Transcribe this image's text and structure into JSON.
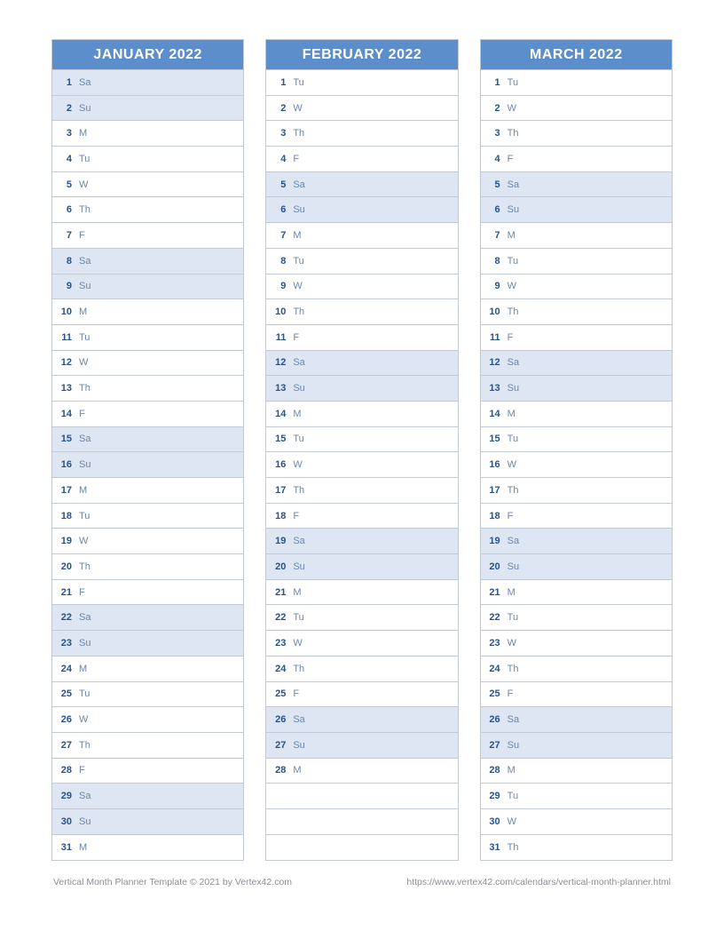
{
  "months": [
    {
      "title": "JANUARY 2022",
      "days": [
        {
          "n": "1",
          "d": "Sa",
          "w": true
        },
        {
          "n": "2",
          "d": "Su",
          "w": true
        },
        {
          "n": "3",
          "d": "M",
          "w": false
        },
        {
          "n": "4",
          "d": "Tu",
          "w": false
        },
        {
          "n": "5",
          "d": "W",
          "w": false
        },
        {
          "n": "6",
          "d": "Th",
          "w": false
        },
        {
          "n": "7",
          "d": "F",
          "w": false
        },
        {
          "n": "8",
          "d": "Sa",
          "w": true
        },
        {
          "n": "9",
          "d": "Su",
          "w": true
        },
        {
          "n": "10",
          "d": "M",
          "w": false
        },
        {
          "n": "11",
          "d": "Tu",
          "w": false
        },
        {
          "n": "12",
          "d": "W",
          "w": false
        },
        {
          "n": "13",
          "d": "Th",
          "w": false
        },
        {
          "n": "14",
          "d": "F",
          "w": false
        },
        {
          "n": "15",
          "d": "Sa",
          "w": true
        },
        {
          "n": "16",
          "d": "Su",
          "w": true
        },
        {
          "n": "17",
          "d": "M",
          "w": false
        },
        {
          "n": "18",
          "d": "Tu",
          "w": false
        },
        {
          "n": "19",
          "d": "W",
          "w": false
        },
        {
          "n": "20",
          "d": "Th",
          "w": false
        },
        {
          "n": "21",
          "d": "F",
          "w": false
        },
        {
          "n": "22",
          "d": "Sa",
          "w": true
        },
        {
          "n": "23",
          "d": "Su",
          "w": true
        },
        {
          "n": "24",
          "d": "M",
          "w": false
        },
        {
          "n": "25",
          "d": "Tu",
          "w": false
        },
        {
          "n": "26",
          "d": "W",
          "w": false
        },
        {
          "n": "27",
          "d": "Th",
          "w": false
        },
        {
          "n": "28",
          "d": "F",
          "w": false
        },
        {
          "n": "29",
          "d": "Sa",
          "w": true
        },
        {
          "n": "30",
          "d": "Su",
          "w": true
        },
        {
          "n": "31",
          "d": "M",
          "w": false
        }
      ]
    },
    {
      "title": "FEBRUARY 2022",
      "days": [
        {
          "n": "1",
          "d": "Tu",
          "w": false
        },
        {
          "n": "2",
          "d": "W",
          "w": false
        },
        {
          "n": "3",
          "d": "Th",
          "w": false
        },
        {
          "n": "4",
          "d": "F",
          "w": false
        },
        {
          "n": "5",
          "d": "Sa",
          "w": true
        },
        {
          "n": "6",
          "d": "Su",
          "w": true
        },
        {
          "n": "7",
          "d": "M",
          "w": false
        },
        {
          "n": "8",
          "d": "Tu",
          "w": false
        },
        {
          "n": "9",
          "d": "W",
          "w": false
        },
        {
          "n": "10",
          "d": "Th",
          "w": false
        },
        {
          "n": "11",
          "d": "F",
          "w": false
        },
        {
          "n": "12",
          "d": "Sa",
          "w": true
        },
        {
          "n": "13",
          "d": "Su",
          "w": true
        },
        {
          "n": "14",
          "d": "M",
          "w": false
        },
        {
          "n": "15",
          "d": "Tu",
          "w": false
        },
        {
          "n": "16",
          "d": "W",
          "w": false
        },
        {
          "n": "17",
          "d": "Th",
          "w": false
        },
        {
          "n": "18",
          "d": "F",
          "w": false
        },
        {
          "n": "19",
          "d": "Sa",
          "w": true
        },
        {
          "n": "20",
          "d": "Su",
          "w": true
        },
        {
          "n": "21",
          "d": "M",
          "w": false
        },
        {
          "n": "22",
          "d": "Tu",
          "w": false
        },
        {
          "n": "23",
          "d": "W",
          "w": false
        },
        {
          "n": "24",
          "d": "Th",
          "w": false
        },
        {
          "n": "25",
          "d": "F",
          "w": false
        },
        {
          "n": "26",
          "d": "Sa",
          "w": true
        },
        {
          "n": "27",
          "d": "Su",
          "w": true
        },
        {
          "n": "28",
          "d": "M",
          "w": false
        },
        {
          "n": "",
          "d": "",
          "w": false
        },
        {
          "n": "",
          "d": "",
          "w": false
        },
        {
          "n": "",
          "d": "",
          "w": false
        }
      ]
    },
    {
      "title": "MARCH 2022",
      "days": [
        {
          "n": "1",
          "d": "Tu",
          "w": false
        },
        {
          "n": "2",
          "d": "W",
          "w": false
        },
        {
          "n": "3",
          "d": "Th",
          "w": false
        },
        {
          "n": "4",
          "d": "F",
          "w": false
        },
        {
          "n": "5",
          "d": "Sa",
          "w": true
        },
        {
          "n": "6",
          "d": "Su",
          "w": true
        },
        {
          "n": "7",
          "d": "M",
          "w": false
        },
        {
          "n": "8",
          "d": "Tu",
          "w": false
        },
        {
          "n": "9",
          "d": "W",
          "w": false
        },
        {
          "n": "10",
          "d": "Th",
          "w": false
        },
        {
          "n": "11",
          "d": "F",
          "w": false
        },
        {
          "n": "12",
          "d": "Sa",
          "w": true
        },
        {
          "n": "13",
          "d": "Su",
          "w": true
        },
        {
          "n": "14",
          "d": "M",
          "w": false
        },
        {
          "n": "15",
          "d": "Tu",
          "w": false
        },
        {
          "n": "16",
          "d": "W",
          "w": false
        },
        {
          "n": "17",
          "d": "Th",
          "w": false
        },
        {
          "n": "18",
          "d": "F",
          "w": false
        },
        {
          "n": "19",
          "d": "Sa",
          "w": true
        },
        {
          "n": "20",
          "d": "Su",
          "w": true
        },
        {
          "n": "21",
          "d": "M",
          "w": false
        },
        {
          "n": "22",
          "d": "Tu",
          "w": false
        },
        {
          "n": "23",
          "d": "W",
          "w": false
        },
        {
          "n": "24",
          "d": "Th",
          "w": false
        },
        {
          "n": "25",
          "d": "F",
          "w": false
        },
        {
          "n": "26",
          "d": "Sa",
          "w": true
        },
        {
          "n": "27",
          "d": "Su",
          "w": true
        },
        {
          "n": "28",
          "d": "M",
          "w": false
        },
        {
          "n": "29",
          "d": "Tu",
          "w": false
        },
        {
          "n": "30",
          "d": "W",
          "w": false
        },
        {
          "n": "31",
          "d": "Th",
          "w": false
        }
      ]
    }
  ],
  "footer": {
    "left": "Vertical Month Planner Template © 2021 by Vertex42.com",
    "right": "https://www.vertex42.com/calendars/vertical-month-planner.html"
  }
}
